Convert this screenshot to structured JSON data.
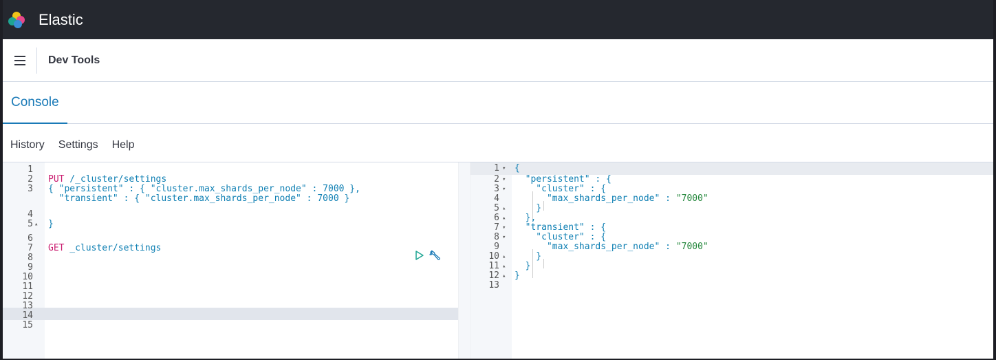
{
  "app": {
    "title": "Elastic"
  },
  "header": {
    "breadcrumb": "Dev Tools"
  },
  "tabs": [
    {
      "label": "Console"
    }
  ],
  "toolbar": {
    "items": [
      "History",
      "Settings",
      "Help"
    ]
  },
  "colors": {
    "accent": "#1a7ab7",
    "topbar": "#25282f",
    "keyword": "#c91a6e",
    "string": "#0e7fb3"
  },
  "request_editor": {
    "line_numbers": [
      "1",
      "2",
      "3",
      "4",
      "5",
      "6",
      "7",
      "8",
      "9",
      "10",
      "11",
      "12",
      "13",
      "14",
      "15"
    ],
    "lines": [
      {
        "n": "1",
        "code": ""
      },
      {
        "n": "2",
        "method": "PUT",
        "rest": " /_cluster/settings"
      },
      {
        "n": "3",
        "code": "{ \"persistent\" : { \"cluster.max_shards_per_node\" : 7000 },"
      },
      {
        "n": "",
        "code": "  \"transient\" : { \"cluster.max_shards_per_node\" : 7000 }"
      },
      {
        "n": "4",
        "code": ""
      },
      {
        "n": "5",
        "code": "}"
      },
      {
        "n": "6",
        "code": ""
      },
      {
        "n": "7",
        "method": "GET",
        "rest": " _cluster/settings"
      },
      {
        "n": "8",
        "code": ""
      },
      {
        "n": "9",
        "code": ""
      },
      {
        "n": "10",
        "code": ""
      },
      {
        "n": "11",
        "code": ""
      },
      {
        "n": "12",
        "code": ""
      },
      {
        "n": "13",
        "code": ""
      },
      {
        "n": "14",
        "code": ""
      },
      {
        "n": "15",
        "code": ""
      }
    ],
    "icons": [
      "play-icon",
      "wrench-icon"
    ]
  },
  "response_editor": {
    "lines": [
      {
        "n": "1",
        "fold": "▾",
        "code": "{"
      },
      {
        "n": "2",
        "fold": "▾",
        "code": "  \"persistent\" : {"
      },
      {
        "n": "3",
        "fold": "▾",
        "code": "    \"cluster\" : {"
      },
      {
        "n": "4",
        "fold": "",
        "key": "      \"max_shards_per_node\" : ",
        "value": "\"7000\""
      },
      {
        "n": "5",
        "fold": "▴",
        "code": "    }"
      },
      {
        "n": "6",
        "fold": "▴",
        "code": "  },"
      },
      {
        "n": "7",
        "fold": "▾",
        "code": "  \"transient\" : {"
      },
      {
        "n": "8",
        "fold": "▾",
        "code": "    \"cluster\" : {"
      },
      {
        "n": "9",
        "fold": "",
        "key": "      \"max_shards_per_node\" : ",
        "value": "\"7000\""
      },
      {
        "n": "10",
        "fold": "▴",
        "code": "    }"
      },
      {
        "n": "11",
        "fold": "▴",
        "code": "  }"
      },
      {
        "n": "12",
        "fold": "▴",
        "code": "}"
      },
      {
        "n": "13",
        "fold": "",
        "code": ""
      }
    ]
  }
}
